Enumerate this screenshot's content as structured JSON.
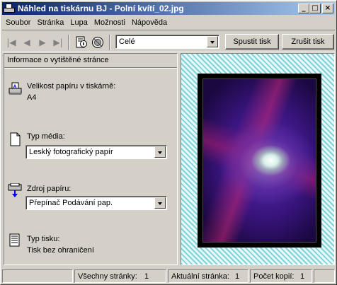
{
  "window": {
    "title": "Náhled na tiskárnu BJ - Polní kvítí_02.jpg",
    "controls": {
      "minimize": "_",
      "maximize": "□",
      "close": "×"
    }
  },
  "menu": [
    "Soubor",
    "Stránka",
    "Lupa",
    "Možnosti",
    "Nápověda"
  ],
  "toolbar": {
    "page_range": "Celé",
    "print_button": "Spustit tisk",
    "cancel_button": "Zrušit tisk"
  },
  "panel": {
    "header": "Informace o vytištěné stránce",
    "paper_size_label": "Velikost papíru v tiskárně:",
    "paper_size_value": "A4",
    "media_type_label": "Typ média:",
    "media_type_value": "Lesklý fotografický papír",
    "paper_source_label": "Zdroj papíru:",
    "paper_source_value": "Přepínač Podávání pap.",
    "print_type_label": "Typ tisku:",
    "print_type_value": "Tisk bez ohraničení"
  },
  "status": {
    "all_pages_label": "Všechny stránky:",
    "all_pages_value": "1",
    "current_page_label": "Aktuální stránka:",
    "current_page_value": "1",
    "copies_label": "Počet kopií:",
    "copies_value": "1"
  },
  "colors": {
    "titlebar_start": "#0a246a",
    "titlebar_end": "#a6caf0",
    "preview_hatch": "#7fd4d8",
    "face": "#d4d0c8"
  }
}
